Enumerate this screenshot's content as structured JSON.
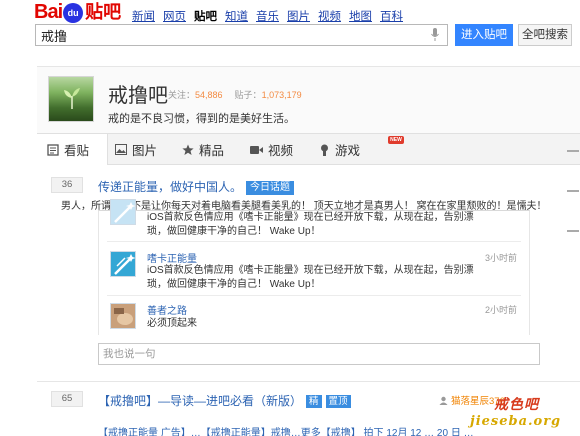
{
  "header": {
    "logo": {
      "left": "Bai",
      "paw": "du",
      "right": "贴吧"
    },
    "nav": [
      "新闻",
      "网页",
      "贴吧",
      "知道",
      "音乐",
      "图片",
      "视频",
      "地图",
      "百科"
    ],
    "search_value": "戒撸",
    "enter_button": "进入贴吧",
    "all_search_button": "全吧搜索"
  },
  "forum": {
    "name": "戒撸吧",
    "followers_label": "关注：",
    "followers": "54,886",
    "posts_label": "贴子：",
    "posts": "1,073,179",
    "slogan": "戒的是不良习惯，得到的是美好生活。"
  },
  "tabs": [
    {
      "label": "看贴",
      "icon": "document-icon"
    },
    {
      "label": "图片",
      "icon": "image-icon"
    },
    {
      "label": "精品",
      "icon": "star-icon"
    },
    {
      "label": "视频",
      "icon": "video-icon"
    },
    {
      "label": "游戏",
      "icon": "person-icon",
      "badge": "NEW"
    }
  ],
  "thread1": {
    "replies": "36",
    "title": "传递正能量，做好中国人。",
    "tag": "今日话题",
    "excerpt": "男人，所谓男人不是让你每天对着电脑看美腿看美乳的！ 顶天立地才是真男人！ 窝在在家里颓败的！是懦夫！窝…"
  },
  "replies": [
    {
      "name": "",
      "text": "iOS首款反色情应用《嗜卡正能量》现在已经开放下载，从现在起，告别漂琐，做回健康干净的自己！ Wake Up！",
      "time": ""
    },
    {
      "name": "嗜卡正能量",
      "text": "iOS首款反色情应用《嗜卡正能量》现在已经开放下载，从现在起，告别漂琐，做回健康干净的自己！ Wake Up！",
      "time": "3小时前"
    },
    {
      "name": "善者之路",
      "text": "必须顶起来",
      "time": "2小时前"
    }
  ],
  "reply_placeholder": "我也说一句",
  "thread2": {
    "replies": "65",
    "title": "【戒撸吧】—导读—进吧必看（新版）",
    "tags": [
      {
        "label": "精",
        "color": "#3a8de0"
      },
      {
        "label": "置顶",
        "color": "#3a8de0"
      }
    ],
    "author": "猫落星辰376"
  },
  "thread3_partial": "【戒撸正能量 广告】…【戒撸正能量】戒撸…更多【戒撸】 拍下 12月 12 … 20 日 …",
  "watermark": {
    "line1": "戒色吧",
    "line2": "jieseba.org"
  }
}
